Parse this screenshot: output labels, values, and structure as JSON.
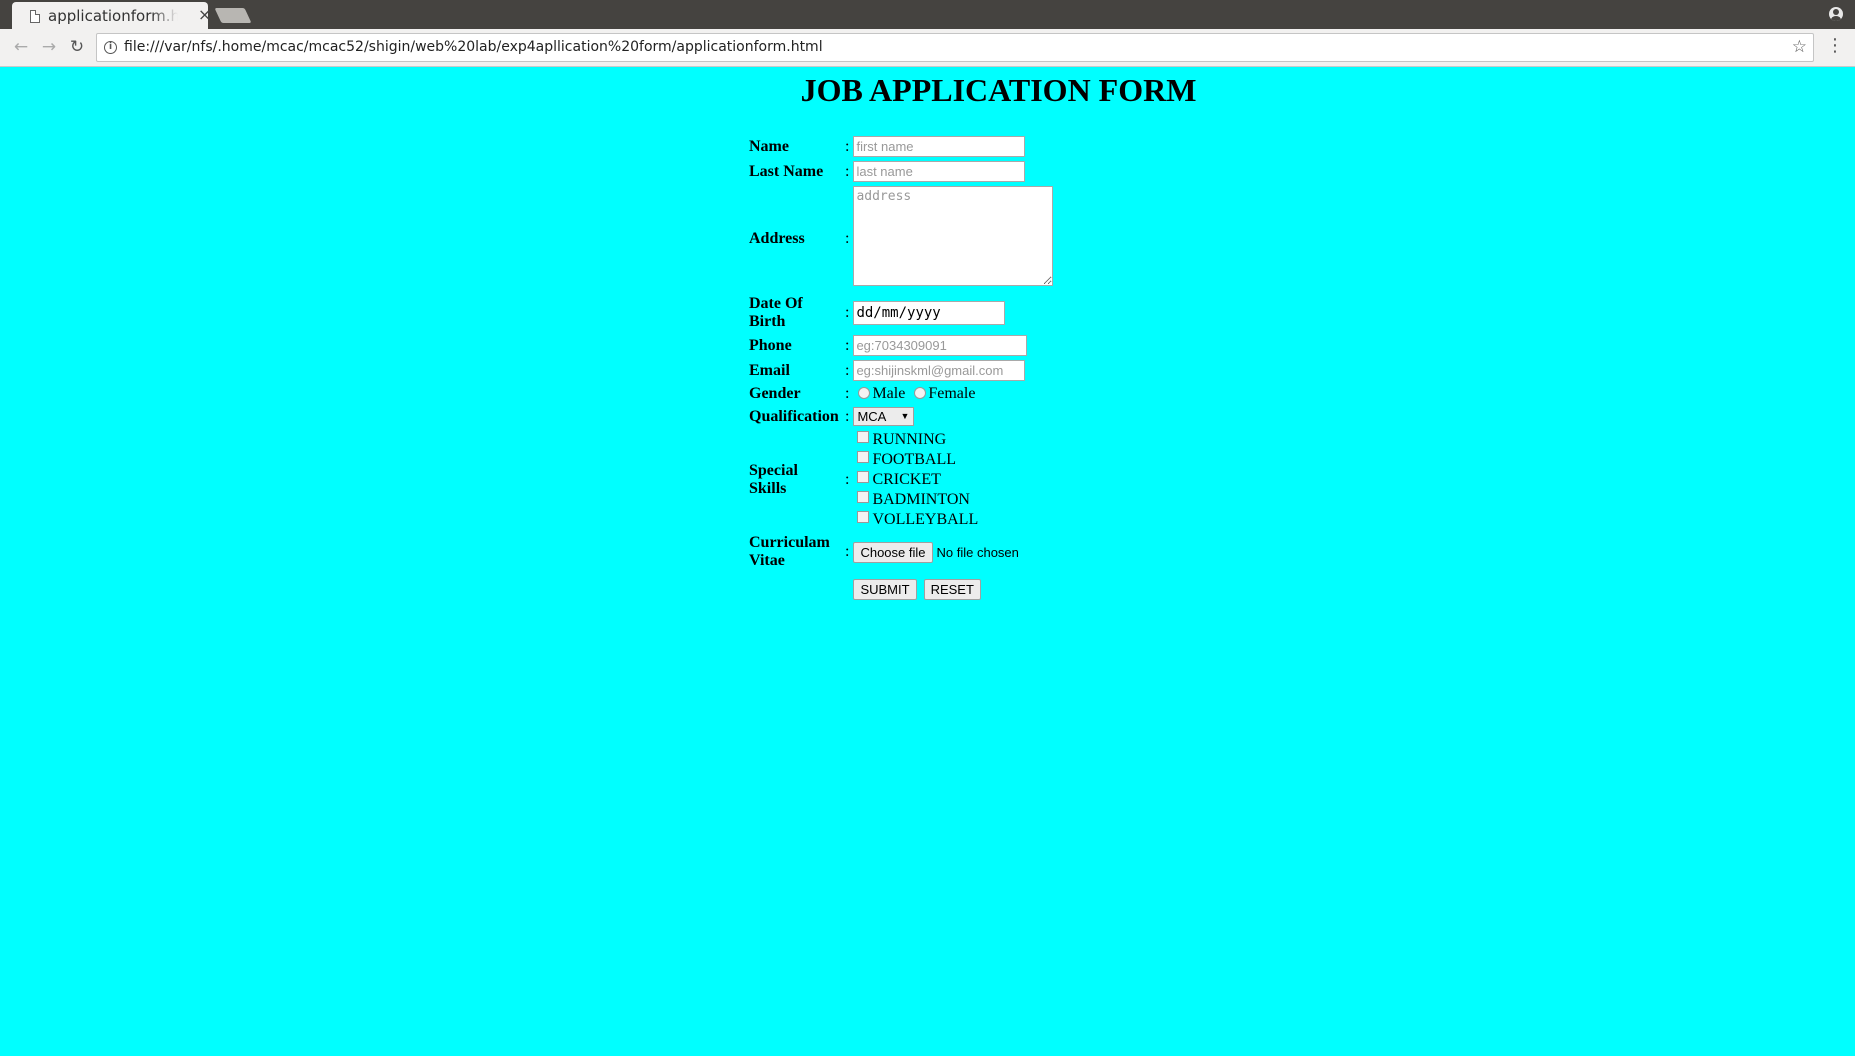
{
  "browser": {
    "tab_title": "applicationform.html",
    "url": "file:///var/nfs/.home/mcac/mcac52/shigin/web%20lab/exp4apllication%20form/applicationform.html"
  },
  "page": {
    "title": "JOB APPLICATION FORM"
  },
  "form": {
    "colon": ":",
    "name": {
      "label": "Name",
      "placeholder": "first name"
    },
    "last_name": {
      "label": "Last Name",
      "placeholder": "last name"
    },
    "address": {
      "label": "Address",
      "placeholder": "address"
    },
    "dob": {
      "label_line1": "Date Of",
      "label_line2": "Birth",
      "value": "dd/mm/yyyy"
    },
    "phone": {
      "label": "Phone",
      "placeholder": "eg:7034309091"
    },
    "email": {
      "label": "Email",
      "placeholder": "eg:shijinskml@gmail.com"
    },
    "gender": {
      "label": "Gender",
      "options": [
        "Male",
        "Female"
      ]
    },
    "qualification": {
      "label": "Qualification",
      "selected": "MCA"
    },
    "skills": {
      "label_line1": "Special",
      "label_line2": "Skills",
      "options": [
        "RUNNING",
        "FOOTBALL",
        "CRICKET",
        "BADMINTON",
        "VOLLEYBALL"
      ]
    },
    "cv": {
      "label_line1": "Curriculam",
      "label_line2": "Vitae",
      "button": "Choose file",
      "status": "No file chosen"
    },
    "submit": "SUBMIT",
    "reset": "RESET"
  }
}
